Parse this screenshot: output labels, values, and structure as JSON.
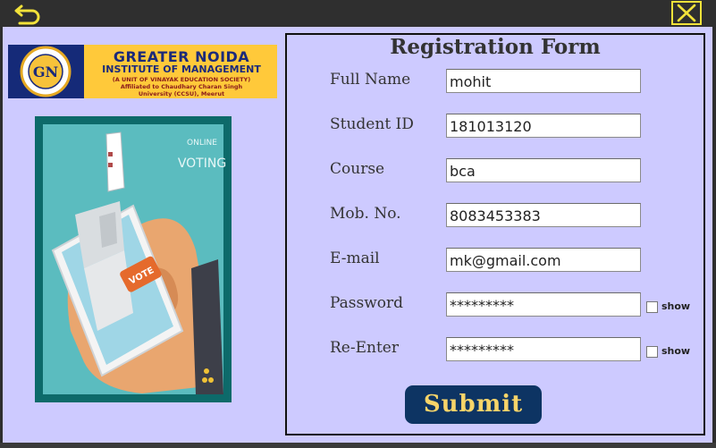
{
  "toolbar": {
    "back_icon": "back-arrow-icon",
    "close_icon": "close-icon",
    "accent_color": "#f2e23a"
  },
  "logo": {
    "title": "GREATER NOIDA",
    "subtitle": "INSTITUTE OF MANAGEMENT",
    "line1": "(A UNIT OF VINAYAK EDUCATION SOCIETY)",
    "line2": "Affiliated to Chaudhary Charan Singh",
    "line3": "University (CCSU), Meerut",
    "emblem_text": "GN"
  },
  "illustration": {
    "caption_top": "ONLINE",
    "caption_bottom": "VOTING",
    "badge": "VOTE"
  },
  "form": {
    "title": "Registration Form",
    "fields": [
      {
        "label": "Full Name",
        "value": "mohit"
      },
      {
        "label": "Student ID",
        "value": "181013120"
      },
      {
        "label": "Course",
        "value": "bca"
      },
      {
        "label": "Mob. No.",
        "value": "8083453383"
      },
      {
        "label": "E-mail",
        "value": "mk@gmail.com"
      },
      {
        "label": "Password",
        "value": "*********",
        "show_label": "show"
      },
      {
        "label": "Re-Enter",
        "value": "*********",
        "show_label": "show"
      }
    ],
    "submit_label": "Submit"
  },
  "colors": {
    "background": "#cdcaff",
    "button": "#0d3463",
    "button_text": "#f7d469",
    "logo_bg": "#ffc93a"
  }
}
